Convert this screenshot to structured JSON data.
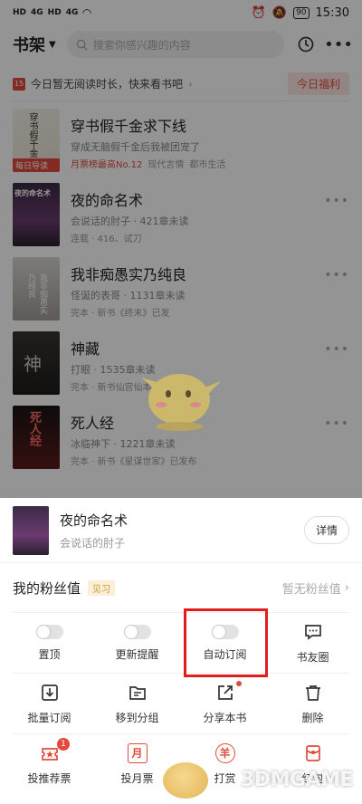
{
  "status": {
    "left": [
      "HD",
      "4G",
      "HD",
      "4G"
    ],
    "battery": "90",
    "time": "15:30"
  },
  "header": {
    "title": "书架",
    "search_placeholder": "搜索你感兴趣的内容"
  },
  "banner": {
    "calendar_day": "15",
    "text": "今日暂无阅读时长，快来看书吧",
    "welfare_button": "今日福利"
  },
  "books": [
    {
      "title": "穿书假千金求下线",
      "subtitle": "穿成无脑假千金后我被团宠了",
      "meta": [
        "月票榜最高No.12",
        "现代言情",
        "都市生活"
      ],
      "cover_tag": "每日导读",
      "cover_text": "穿书假千金"
    },
    {
      "title": "夜的命名术",
      "subtitle": "会说话的肘子 · 421章未读",
      "meta": [
        "连载 · 416、试刀"
      ],
      "cover_text": "夜的命名术"
    },
    {
      "title": "我非痴愚实乃纯良",
      "subtitle": "怪诞的表哥 · 1131章未读",
      "meta": [
        "完本 · 新书《终末》已发"
      ],
      "cover_text": "我非痴愚实乃纯良"
    },
    {
      "title": "神藏",
      "subtitle": "打眼 · 1535章未读",
      "meta": [
        "完本 · 新书仙宫仙本尽宴上传了"
      ],
      "cover_text": "神"
    },
    {
      "title": "死人经",
      "subtitle": "冰临神下 · 1221章未读",
      "meta": [
        "完本 · 新书《星谋世家》已发布"
      ],
      "cover_text": "死人经"
    }
  ],
  "sheet": {
    "book_title": "夜的命名术",
    "book_author": "会说话的肘子",
    "detail_button": "详情",
    "fan_label": "我的粉丝值",
    "fan_tag": "见习",
    "fan_value": "暂无粉丝值"
  },
  "actions_row1": [
    {
      "label": "置顶",
      "type": "toggle"
    },
    {
      "label": "更新提醒",
      "type": "toggle"
    },
    {
      "label": "自动订阅",
      "type": "toggle"
    },
    {
      "label": "书友圈",
      "type": "icon",
      "icon": "chat-icon"
    }
  ],
  "actions_row2": [
    {
      "label": "批量订阅",
      "icon": "download-icon"
    },
    {
      "label": "移到分组",
      "icon": "folder-icon"
    },
    {
      "label": "分享本书",
      "icon": "share-icon"
    },
    {
      "label": "删除",
      "icon": "trash-icon"
    }
  ],
  "actions_row3": [
    {
      "label": "投推荐票",
      "icon": "ticket-icon",
      "badge": "1"
    },
    {
      "label": "投月票",
      "icon": "month-ticket-icon",
      "glyph": "月"
    },
    {
      "label": "打赏",
      "icon": "reward-icon",
      "glyph": "羊"
    },
    {
      "label": "红包",
      "icon": "red-packet-icon"
    }
  ],
  "watermark": "3DMGAME",
  "colors": {
    "accent": "#e24b3c",
    "highlight": "#e01e1e"
  }
}
